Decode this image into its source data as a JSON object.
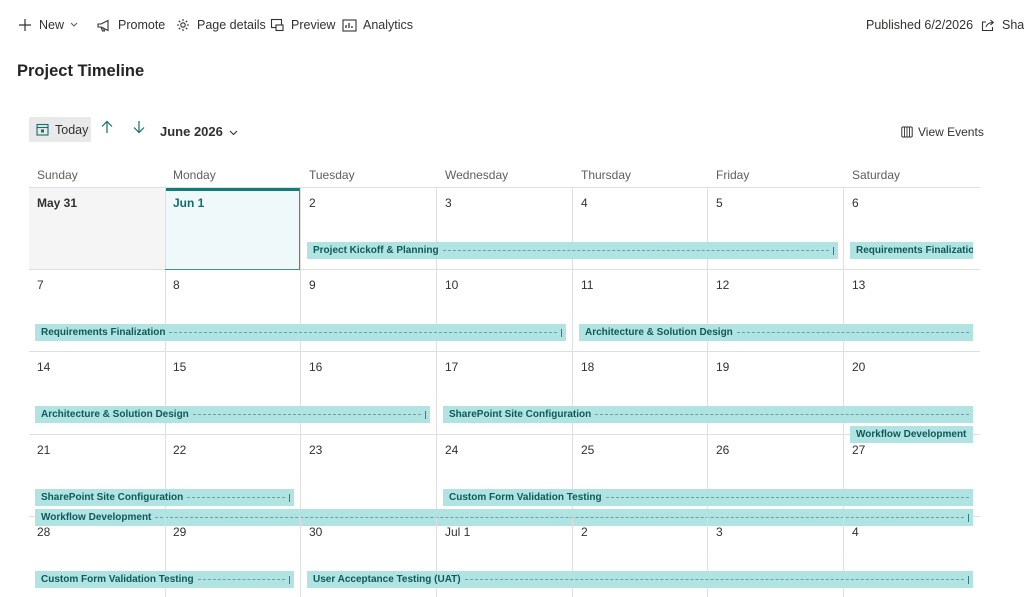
{
  "commandbar": {
    "new_label": "New",
    "promote_label": "Promote",
    "page_details_label": "Page details",
    "preview_label": "Preview",
    "analytics_label": "Analytics",
    "published_label": "Published 6/2/2026",
    "share_label": "Share"
  },
  "page": {
    "title": "Project Timeline"
  },
  "calendar": {
    "today_label": "Today",
    "month_label": "June 2026",
    "view_events_label": "View Events",
    "weekdays": [
      "Sunday",
      "Monday",
      "Tuesday",
      "Wednesday",
      "Thursday",
      "Friday",
      "Saturday"
    ],
    "weeks": [
      [
        "May 31",
        "Jun 1",
        "2",
        "3",
        "4",
        "5",
        "6"
      ],
      [
        "7",
        "8",
        "9",
        "10",
        "11",
        "12",
        "13"
      ],
      [
        "14",
        "15",
        "16",
        "17",
        "18",
        "19",
        "20"
      ],
      [
        "21",
        "22",
        "23",
        "24",
        "25",
        "26",
        "27"
      ],
      [
        "28",
        "29",
        "30",
        "Jul 1",
        "2",
        "3",
        "4"
      ]
    ],
    "events": [
      "Project Kickoff & Planning",
      "Requirements Finalization",
      "Requirements Finalization",
      "Architecture & Solution Design",
      "Architecture & Solution Design",
      "SharePoint Site Configuration",
      "Workflow Development",
      "SharePoint Site Configuration",
      "Custom Form Validation Testing",
      "Workflow Development",
      "Custom Form Validation Testing",
      "User Acceptance Testing (UAT)"
    ]
  },
  "colors": {
    "event_bg": "#b0e3e2",
    "event_text": "#0e5a58",
    "today_border": "#147c78",
    "accent": "#0f6f6b"
  }
}
